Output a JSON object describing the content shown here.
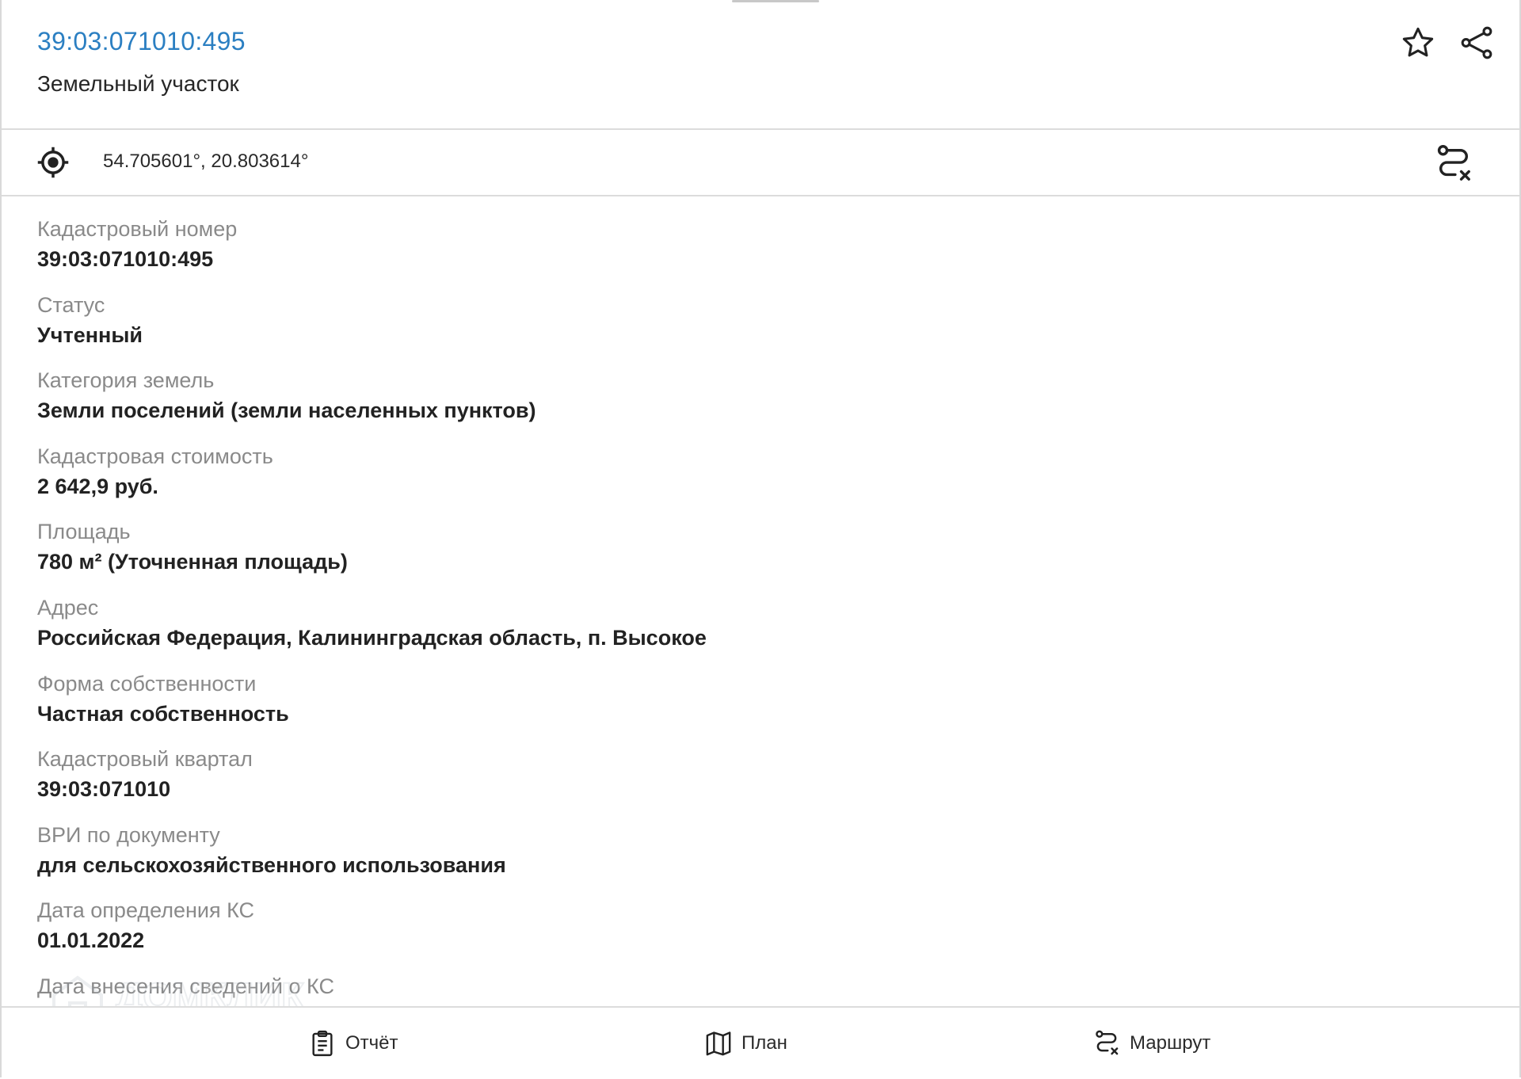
{
  "header": {
    "title": "39:03:071010:495",
    "subtitle": "Земельный участок",
    "favorite_icon": "star-icon",
    "share_icon": "share-icon"
  },
  "location": {
    "coordinates": "54.705601°, 20.803614°",
    "locate_icon": "crosshair-icon",
    "route_icon": "route-clear-icon"
  },
  "details": [
    {
      "label": "Кадастровый номер",
      "value": "39:03:071010:495"
    },
    {
      "label": "Статус",
      "value": "Учтенный"
    },
    {
      "label": "Категория земель",
      "value": "Земли поселений (земли населенных пунктов)"
    },
    {
      "label": "Кадастровая стоимость",
      "value": "2 642,9 руб."
    },
    {
      "label": "Площадь",
      "value": "780 м² (Уточненная площадь)"
    },
    {
      "label": "Адрес",
      "value": "Российская Федерация, Калининградская область, п. Высокое"
    },
    {
      "label": "Форма собственности",
      "value": "Частная собственность"
    },
    {
      "label": "Кадастровый квартал",
      "value": "39:03:071010"
    },
    {
      "label": "ВРИ по документу",
      "value": "для сельскохозяйственного использования"
    },
    {
      "label": "Дата определения КС",
      "value": "01.01.2022"
    },
    {
      "label": "Дата внесения сведений о КС",
      "value": ""
    }
  ],
  "watermark": "ДОМКЛИК",
  "bottom_bar": {
    "report_label": "Отчёт",
    "plan_label": "План",
    "route_label": "Маршрут"
  },
  "colors": {
    "accent": "#2b7fc2",
    "label": "#8a8a8a",
    "value": "#222222",
    "divider": "#dcdcdc"
  }
}
